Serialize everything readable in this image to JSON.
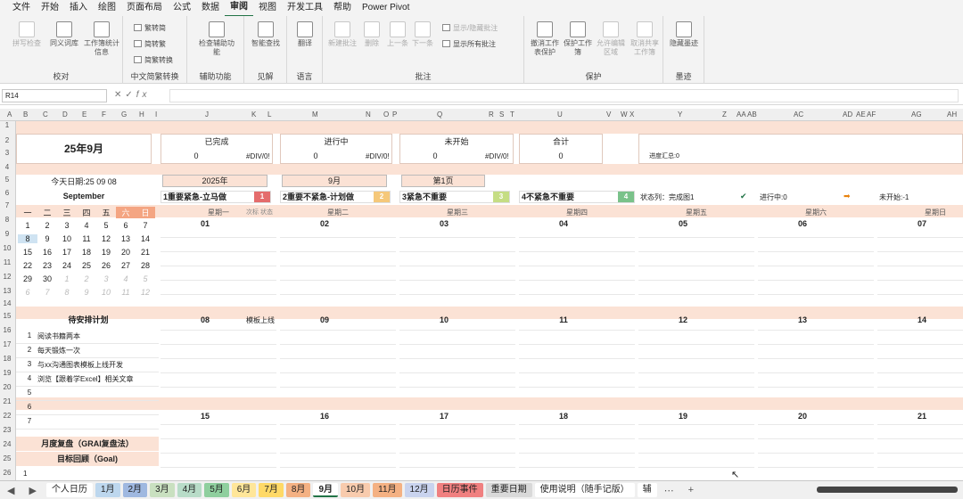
{
  "menu": [
    "文件",
    "开始",
    "插入",
    "绘图",
    "页面布局",
    "公式",
    "数据",
    "审阅",
    "视图",
    "开发工具",
    "帮助",
    "Power Pivot"
  ],
  "ribbon": {
    "proofing": {
      "title": "校对",
      "spell": "拼写检查",
      "thesaurus": "同义词库",
      "stats": "工作簿统计信息"
    },
    "chinese": {
      "title": "中文简繁转换",
      "s2t": "繁转简",
      "t2s": "简转繁",
      "convert": "简繁转换"
    },
    "accessibility": {
      "title": "辅助功能",
      "check": "检查辅助功能"
    },
    "insights": {
      "title": "见解",
      "smart": "智能查找"
    },
    "language": {
      "title": "语言",
      "translate": "翻译"
    },
    "comments": {
      "title": "批注",
      "new": "新建批注",
      "delete": "删除",
      "prev": "上一条",
      "next": "下一条",
      "show_hide": "显示/隐藏批注",
      "show_all": "显示所有批注"
    },
    "protect": {
      "title": "保护",
      "unprotect_sheet": "撤消工作表保护",
      "protect_wb": "保护工作簿",
      "allow_edit": "允许编辑区域",
      "unshare": "取消共享工作簿"
    },
    "ink": {
      "title": "墨迹",
      "hide_ink": "隐藏墨迹"
    }
  },
  "formula_bar": {
    "name_box": "R14",
    "fx": "fx"
  },
  "columns": [
    "A",
    "B",
    "C",
    "D",
    "E",
    "F",
    "G",
    "H",
    "I",
    "J",
    "K",
    "L",
    "M",
    "N",
    "O",
    "P",
    "Q",
    "R",
    "S",
    "T",
    "U",
    "V",
    "W",
    "X",
    "Y",
    "Z",
    "AA",
    "AB",
    "AC",
    "AD",
    "AE",
    "AF",
    "AG",
    "AH"
  ],
  "rows": [
    "1",
    "2",
    "3",
    "4",
    "5",
    "6",
    "7",
    "8",
    "9",
    "10",
    "11",
    "12",
    "13",
    "14",
    "15",
    "16",
    "17",
    "18",
    "19",
    "20",
    "21",
    "22",
    "23",
    "24",
    "25",
    "26"
  ],
  "title": "25年9月",
  "today": "今天日期:25 09 08",
  "status": {
    "done": {
      "label": "已完成",
      "count": "0",
      "pct": "#DIV/0!"
    },
    "doing": {
      "label": "进行中",
      "count": "0",
      "pct": "#DIV/0!"
    },
    "todo": {
      "label": "未开始",
      "count": "0",
      "pct": "#DIV/0!"
    },
    "total": {
      "label": "合计",
      "count": "0"
    },
    "progress": "进度汇总:0"
  },
  "selectors": {
    "year": "2025年",
    "month": "9月",
    "page": "第1页"
  },
  "quadrants": [
    {
      "label": "1重要紧急-立马做",
      "badge": "1",
      "color": "#e46c6c"
    },
    {
      "label": "2重要不紧急-计划做",
      "badge": "2",
      "color": "#f5c87a"
    },
    {
      "label": "3紧急不重要",
      "badge": "3",
      "color": "#c5dd84"
    },
    {
      "label": "4不紧急不重要",
      "badge": "4",
      "color": "#7ac28a"
    }
  ],
  "legend": {
    "done": "状态列：完成图1",
    "doing": "进行中:0",
    "todo": "未开始:-1"
  },
  "calendar": {
    "month_name": "September",
    "weekdays": [
      "一",
      "二",
      "三",
      "四",
      "五",
      "六",
      "日"
    ],
    "weeks": [
      [
        "1",
        "2",
        "3",
        "4",
        "5",
        "6",
        "7"
      ],
      [
        "8",
        "9",
        "10",
        "11",
        "12",
        "13",
        "14"
      ],
      [
        "15",
        "16",
        "17",
        "18",
        "19",
        "20",
        "21"
      ],
      [
        "22",
        "23",
        "24",
        "25",
        "26",
        "27",
        "28"
      ],
      [
        "29",
        "30",
        "1",
        "2",
        "3",
        "4",
        "5"
      ],
      [
        "6",
        "7",
        "8",
        "9",
        "10",
        "11",
        "12"
      ]
    ]
  },
  "week_days": [
    "星期一",
    "星期二",
    "星期三",
    "星期四",
    "星期五",
    "星期六",
    "星期日"
  ],
  "col_sub": {
    "left": "次标",
    "right": "状态"
  },
  "week1_dates": [
    "01",
    "02",
    "03",
    "04",
    "05",
    "06",
    "07"
  ],
  "week2_dates": [
    "08",
    "09",
    "10",
    "11",
    "12",
    "13",
    "14"
  ],
  "week2_note": "模板上线",
  "week3_dates": [
    "15",
    "16",
    "17",
    "18",
    "19",
    "20",
    "21"
  ],
  "pending": {
    "title": "待安排计划",
    "items": [
      {
        "n": "1",
        "t": "阅读书籍两本"
      },
      {
        "n": "2",
        "t": "每天锻炼一次"
      },
      {
        "n": "3",
        "t": "与xx沟通图表模板上线开发"
      },
      {
        "n": "4",
        "t": "浏览【跟着学Excel】相关文章"
      },
      {
        "n": "5",
        "t": ""
      },
      {
        "n": "6",
        "t": ""
      },
      {
        "n": "7",
        "t": ""
      }
    ]
  },
  "review": {
    "title": "月度复盘（GRAI复盘法）",
    "goal": "目标回顾（Goal)",
    "first": "1"
  },
  "tabs": [
    "个人日历",
    "1月",
    "2月",
    "3月",
    "4月",
    "5月",
    "6月",
    "7月",
    "8月",
    "9月",
    "10月",
    "11月",
    "12月",
    "日历事件",
    "重要日期",
    "使用说明（随手记版）",
    "辅"
  ],
  "tab_colors": [
    "#ffffff",
    "#bdd7ee",
    "#9fb8e0",
    "#c9e0c0",
    "#b8dcc8",
    "#8fcf9e",
    "#ffe699",
    "#ffd966",
    "#f4b183",
    "#ffffff",
    "#f8cbad",
    "#f4b183",
    "#c9d3ee",
    "#f08080",
    "#d9d9d9",
    "#ffffff",
    "#ffffff"
  ],
  "active_tab": "9月"
}
